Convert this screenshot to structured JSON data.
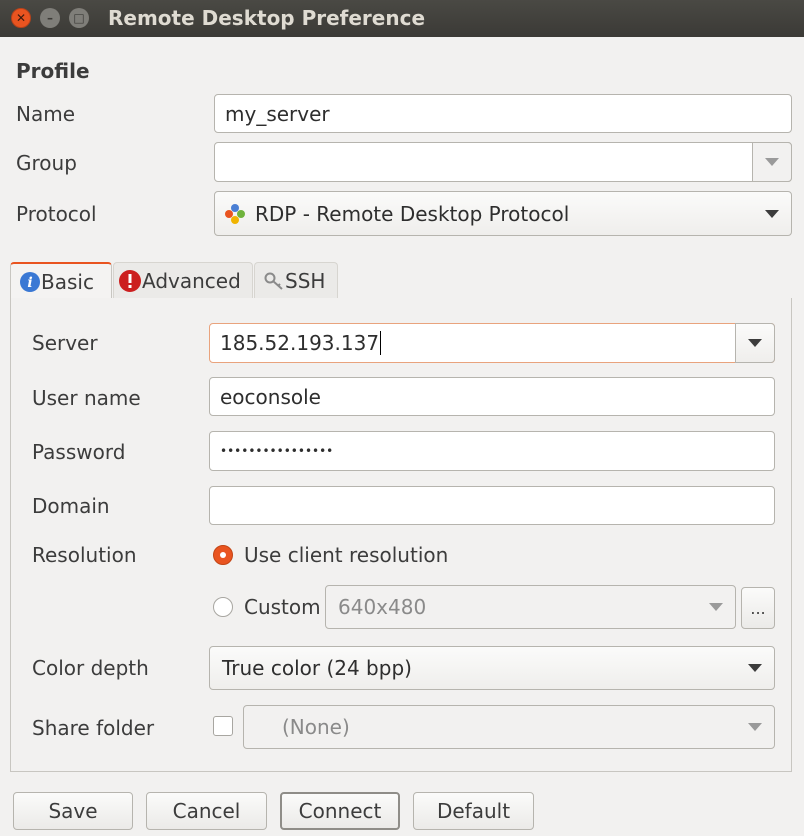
{
  "window": {
    "title": "Remote Desktop Preference"
  },
  "profile": {
    "heading": "Profile",
    "name_label": "Name",
    "name_value": "my_server",
    "group_label": "Group",
    "group_value": "",
    "protocol_label": "Protocol",
    "protocol_value": "RDP - Remote Desktop Protocol"
  },
  "tabs": [
    {
      "label": "Basic",
      "icon": "info-icon"
    },
    {
      "label": "Advanced",
      "icon": "warning-icon"
    },
    {
      "label": "SSH",
      "icon": "key-icon"
    }
  ],
  "basic": {
    "server_label": "Server",
    "server_value": "185.52.193.137",
    "username_label": "User name",
    "username_value": "eoconsole",
    "password_label": "Password",
    "password_value": "••••••••••••••••",
    "domain_label": "Domain",
    "domain_value": "",
    "resolution_label": "Resolution",
    "use_client_resolution_label": "Use client resolution",
    "custom_label": "Custom",
    "custom_value": "640x480",
    "custom_button_label": "...",
    "color_depth_label": "Color depth",
    "color_depth_value": "True color (24 bpp)",
    "share_folder_label": "Share folder",
    "share_folder_value": "(None)"
  },
  "buttons": {
    "save": "Save",
    "cancel": "Cancel",
    "connect": "Connect",
    "default": "Default"
  },
  "colors": {
    "accent": "#e95420",
    "titlebar": "#3c3b37"
  }
}
